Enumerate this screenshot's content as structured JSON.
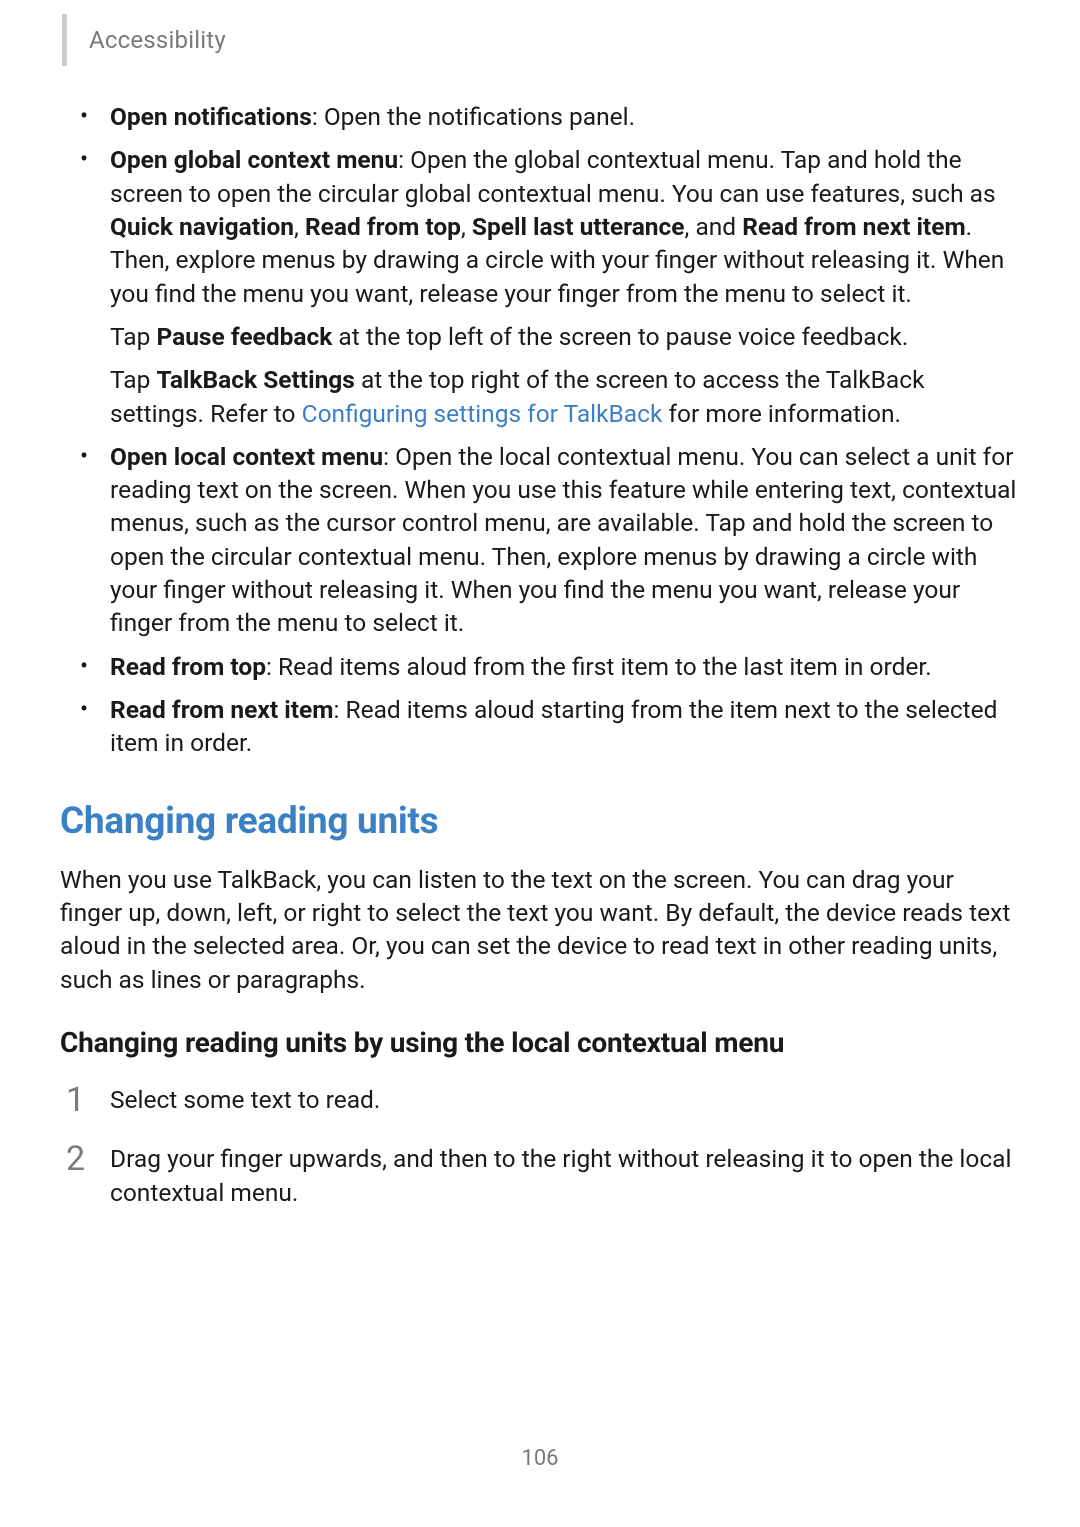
{
  "header": {
    "section_label": "Accessibility"
  },
  "bullets": {
    "b1_bold": "Open notifications",
    "b1_rest": ": Open the notifications panel.",
    "b2_bold": "Open global context menu",
    "b2_text1": ": Open the global contextual menu. Tap and hold the screen to open the circular global contextual menu. You can use features, such as ",
    "b2_quick": "Quick navigation",
    "b2_c1": ", ",
    "b2_read_top": "Read from top",
    "b2_c2": ", ",
    "b2_spell": "Spell last utterance",
    "b2_c3": ", and ",
    "b2_read_next": "Read from next item",
    "b2_text2": ". Then, explore menus by drawing a circle with your finger without releasing it. When you find the menu you want, release your finger from the menu to select it.",
    "b2_p2_pre": "Tap ",
    "b2_p2_bold": "Pause feedback",
    "b2_p2_rest": " at the top left of the screen to pause voice feedback.",
    "b2_p3_pre": "Tap ",
    "b2_p3_bold": "TalkBack Settings",
    "b2_p3_mid": " at the top right of the screen to access the TalkBack settings. Refer to ",
    "b2_p3_link": "Configuring settings for TalkBack",
    "b2_p3_rest": " for more information.",
    "b3_bold": "Open local context menu",
    "b3_rest": ": Open the local contextual menu. You can select a unit for reading text on the screen. When you use this feature while entering text, contextual menus, such as the cursor control menu, are available. Tap and hold the screen to open the circular contextual menu. Then, explore menus by drawing a circle with your finger without releasing it. When you find the menu you want, release your finger from the menu to select it.",
    "b4_bold": "Read from top",
    "b4_rest": ": Read items aloud from the first item to the last item in order.",
    "b5_bold": "Read from next item",
    "b5_rest": ": Read items aloud starting from the item next to the selected item in order."
  },
  "section": {
    "heading": "Changing reading units",
    "para": "When you use TalkBack, you can listen to the text on the screen. You can drag your finger up, down, left, or right to select the text you want. By default, the device reads text aloud in the selected area. Or, you can set the device to read text in other reading units, such as lines or paragraphs.",
    "subheading": "Changing reading units by using the local contextual menu"
  },
  "steps": {
    "s1_num": "1",
    "s1": "Select some text to read.",
    "s2_num": "2",
    "s2": "Drag your finger upwards, and then to the right without releasing it to open the local contextual menu."
  },
  "page_number": "106"
}
